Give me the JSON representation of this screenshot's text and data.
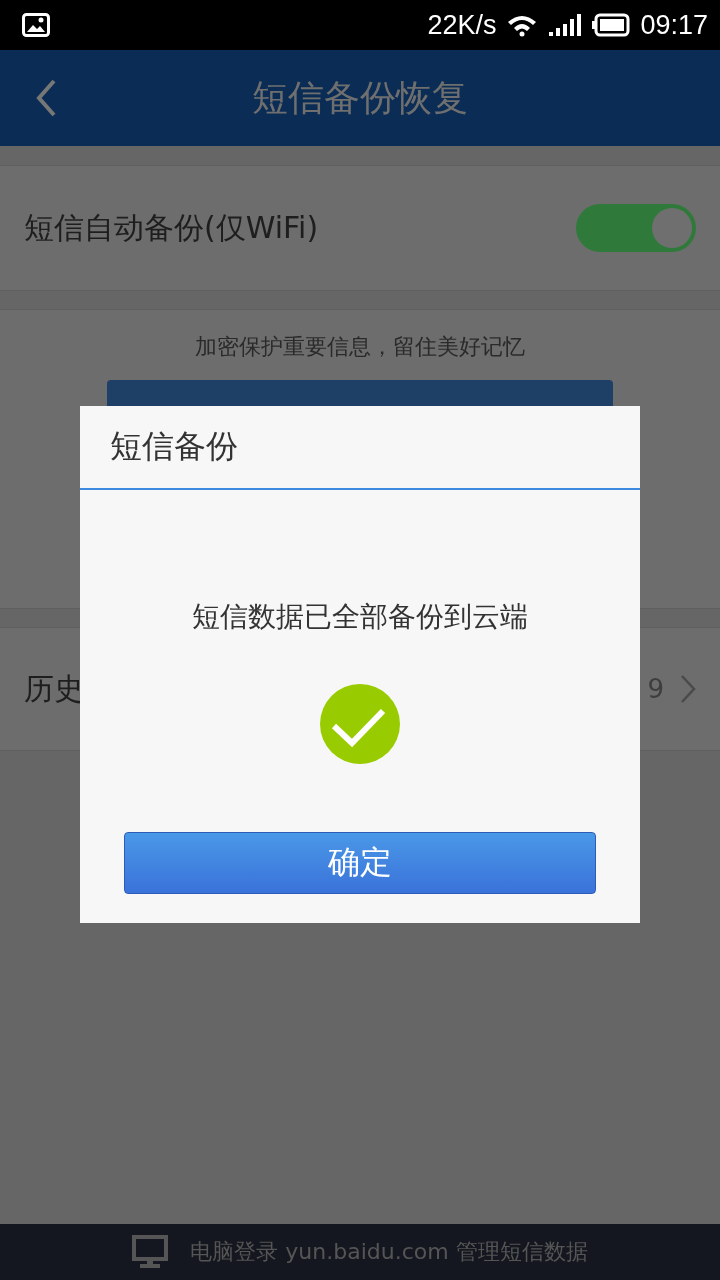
{
  "status_bar": {
    "speed": "22K/s",
    "time": "09:17"
  },
  "header": {
    "title": "短信备份恢复"
  },
  "auto_backup": {
    "label": "短信自动备份(仅WiFi)",
    "on": true
  },
  "backup_card": {
    "subtitle": "加密保护重要信息，留住美好记忆"
  },
  "history_row": {
    "label": "历史",
    "value": "9"
  },
  "dialog": {
    "title": "短信备份",
    "message": "短信数据已全部备份到云端",
    "button": "确定"
  },
  "footer": {
    "text": "电脑登录 yun.baidu.com 管理短信数据"
  }
}
